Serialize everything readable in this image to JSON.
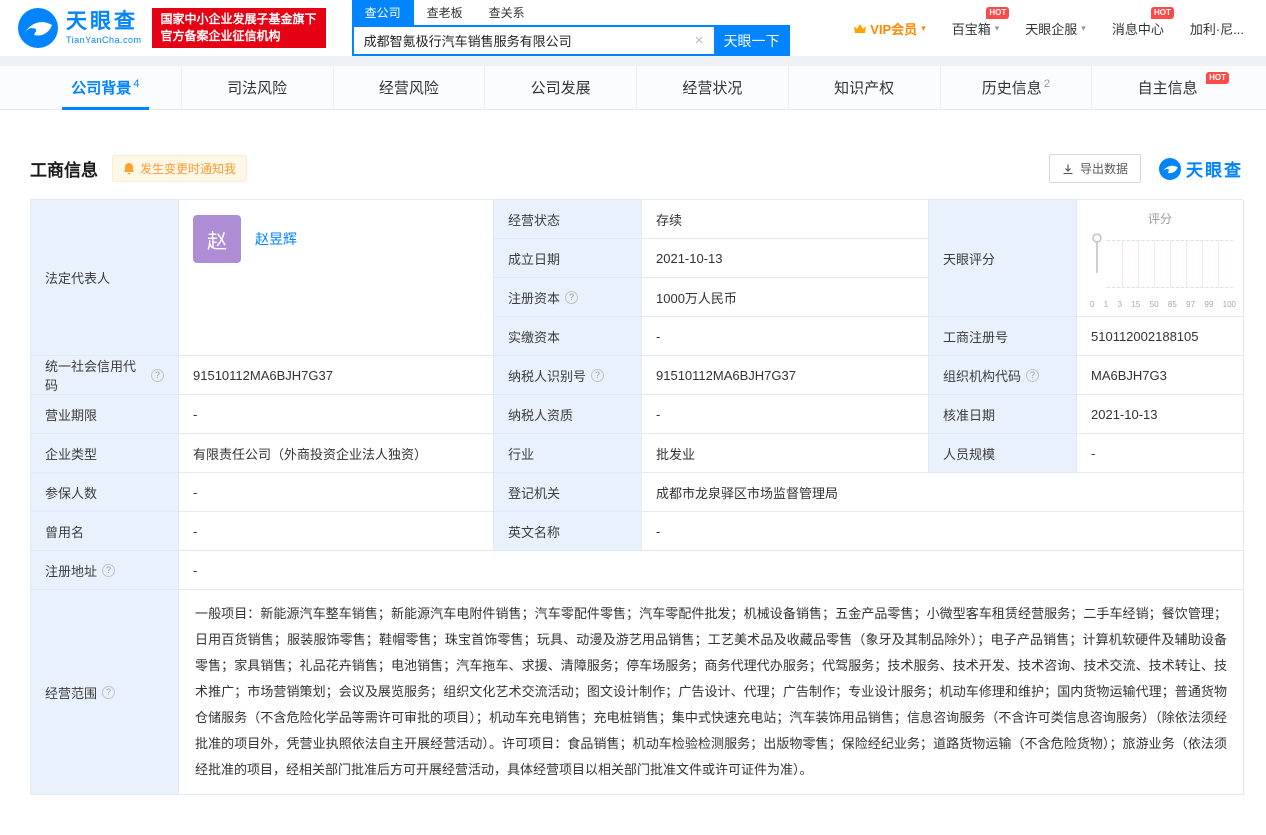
{
  "header": {
    "logo_title": "天眼查",
    "logo_sub": "TianYanCha.com",
    "cert_line1": "国家中小企业发展子基金旗下",
    "cert_line2": "官方备案企业征信机构",
    "search_tabs": {
      "company": "查公司",
      "boss": "查老板",
      "relation": "查关系"
    },
    "search_value": "成都智氪极行汽车销售服务有限公司",
    "search_button": "天眼一下",
    "nav": {
      "vip": "VIP会员",
      "toolbox": "百宝箱",
      "toolbox_hot": "HOT",
      "enterprise": "天眼企服",
      "messages": "消息中心",
      "messages_hot": "HOT",
      "username": "加利·尼..."
    }
  },
  "tabs": {
    "items": [
      {
        "label": "公司背景",
        "count": "4",
        "active": true
      },
      {
        "label": "司法风险"
      },
      {
        "label": "经营风险"
      },
      {
        "label": "公司发展"
      },
      {
        "label": "经营状况"
      },
      {
        "label": "知识产权"
      },
      {
        "label": "历史信息",
        "count": "2"
      },
      {
        "label": "自主信息",
        "hot": "HOT"
      }
    ]
  },
  "section": {
    "title": "工商信息",
    "notify": "发生变更时通知我",
    "export": "导出数据",
    "brand": "天眼查"
  },
  "table": {
    "legal_rep_label": "法定代表人",
    "legal_rep_avatar": "赵",
    "legal_rep_name": "赵昱辉",
    "status_label": "经营状态",
    "status_value": "存续",
    "established_label": "成立日期",
    "established_value": "2021-10-13",
    "reg_capital_label": "注册资本",
    "reg_capital_value": "1000万人民币",
    "paid_capital_label": "实缴资本",
    "paid_capital_value": "-",
    "score_label": "天眼评分",
    "score_title": "评分",
    "score_ticks": [
      "0",
      "1",
      "3",
      "15",
      "50",
      "85",
      "97",
      "99",
      "100"
    ],
    "reg_no_label": "工商注册号",
    "reg_no_value": "510112002188105",
    "credit_code_label": "统一社会信用代码",
    "credit_code_value": "91510112MA6BJH7G37",
    "taxpayer_id_label": "纳税人识别号",
    "taxpayer_id_value": "91510112MA6BJH7G37",
    "org_code_label": "组织机构代码",
    "org_code_value": "MA6BJH7G3",
    "business_term_label": "营业期限",
    "business_term_value": "-",
    "taxpayer_quality_label": "纳税人资质",
    "taxpayer_quality_value": "-",
    "approval_date_label": "核准日期",
    "approval_date_value": "2021-10-13",
    "company_type_label": "企业类型",
    "company_type_value": "有限责任公司（外商投资企业法人独资）",
    "industry_label": "行业",
    "industry_value": "批发业",
    "staff_size_label": "人员规模",
    "staff_size_value": "-",
    "insured_label": "参保人数",
    "insured_value": "-",
    "registry_label": "登记机关",
    "registry_value": "成都市龙泉驿区市场监督管理局",
    "former_name_label": "曾用名",
    "former_name_value": "-",
    "english_name_label": "英文名称",
    "english_name_value": "-",
    "address_label": "注册地址",
    "address_value": "-",
    "scope_label": "经营范围",
    "scope_value": "一般项目：新能源汽车整车销售；新能源汽车电附件销售；汽车零配件零售；汽车零配件批发；机械设备销售；五金产品零售；小微型客车租赁经营服务；二手车经销；餐饮管理；日用百货销售；服装服饰零售；鞋帽零售；珠宝首饰零售；玩具、动漫及游艺用品销售；工艺美术品及收藏品零售（象牙及其制品除外）；电子产品销售；计算机软硬件及辅助设备零售；家具销售；礼品花卉销售；电池销售；汽车拖车、求援、清障服务；停车场服务；商务代理代办服务；代驾服务；技术服务、技术开发、技术咨询、技术交流、技术转让、技术推广；市场营销策划；会议及展览服务；组织文化艺术交流活动；图文设计制作；广告设计、代理；广告制作；专业设计服务；机动车修理和维护；国内货物运输代理；普通货物仓储服务（不含危险化学品等需许可审批的项目）；机动车充电销售；充电桩销售；集中式快速充电站；汽车装饰用品销售；信息咨询服务（不含许可类信息咨询服务）（除依法须经批准的项目外，凭营业执照依法自主开展经营活动）。许可项目：食品销售；机动车检验检测服务；出版物零售；保险经纪业务；道路货物运输（不含危险货物）；旅游业务（依法须经批准的项目，经相关部门批准后方可开展经营活动，具体经营项目以相关部门批准文件或许可证件为准）。"
  },
  "icons": {
    "clear": "×",
    "caret": "▾",
    "question": "?"
  }
}
